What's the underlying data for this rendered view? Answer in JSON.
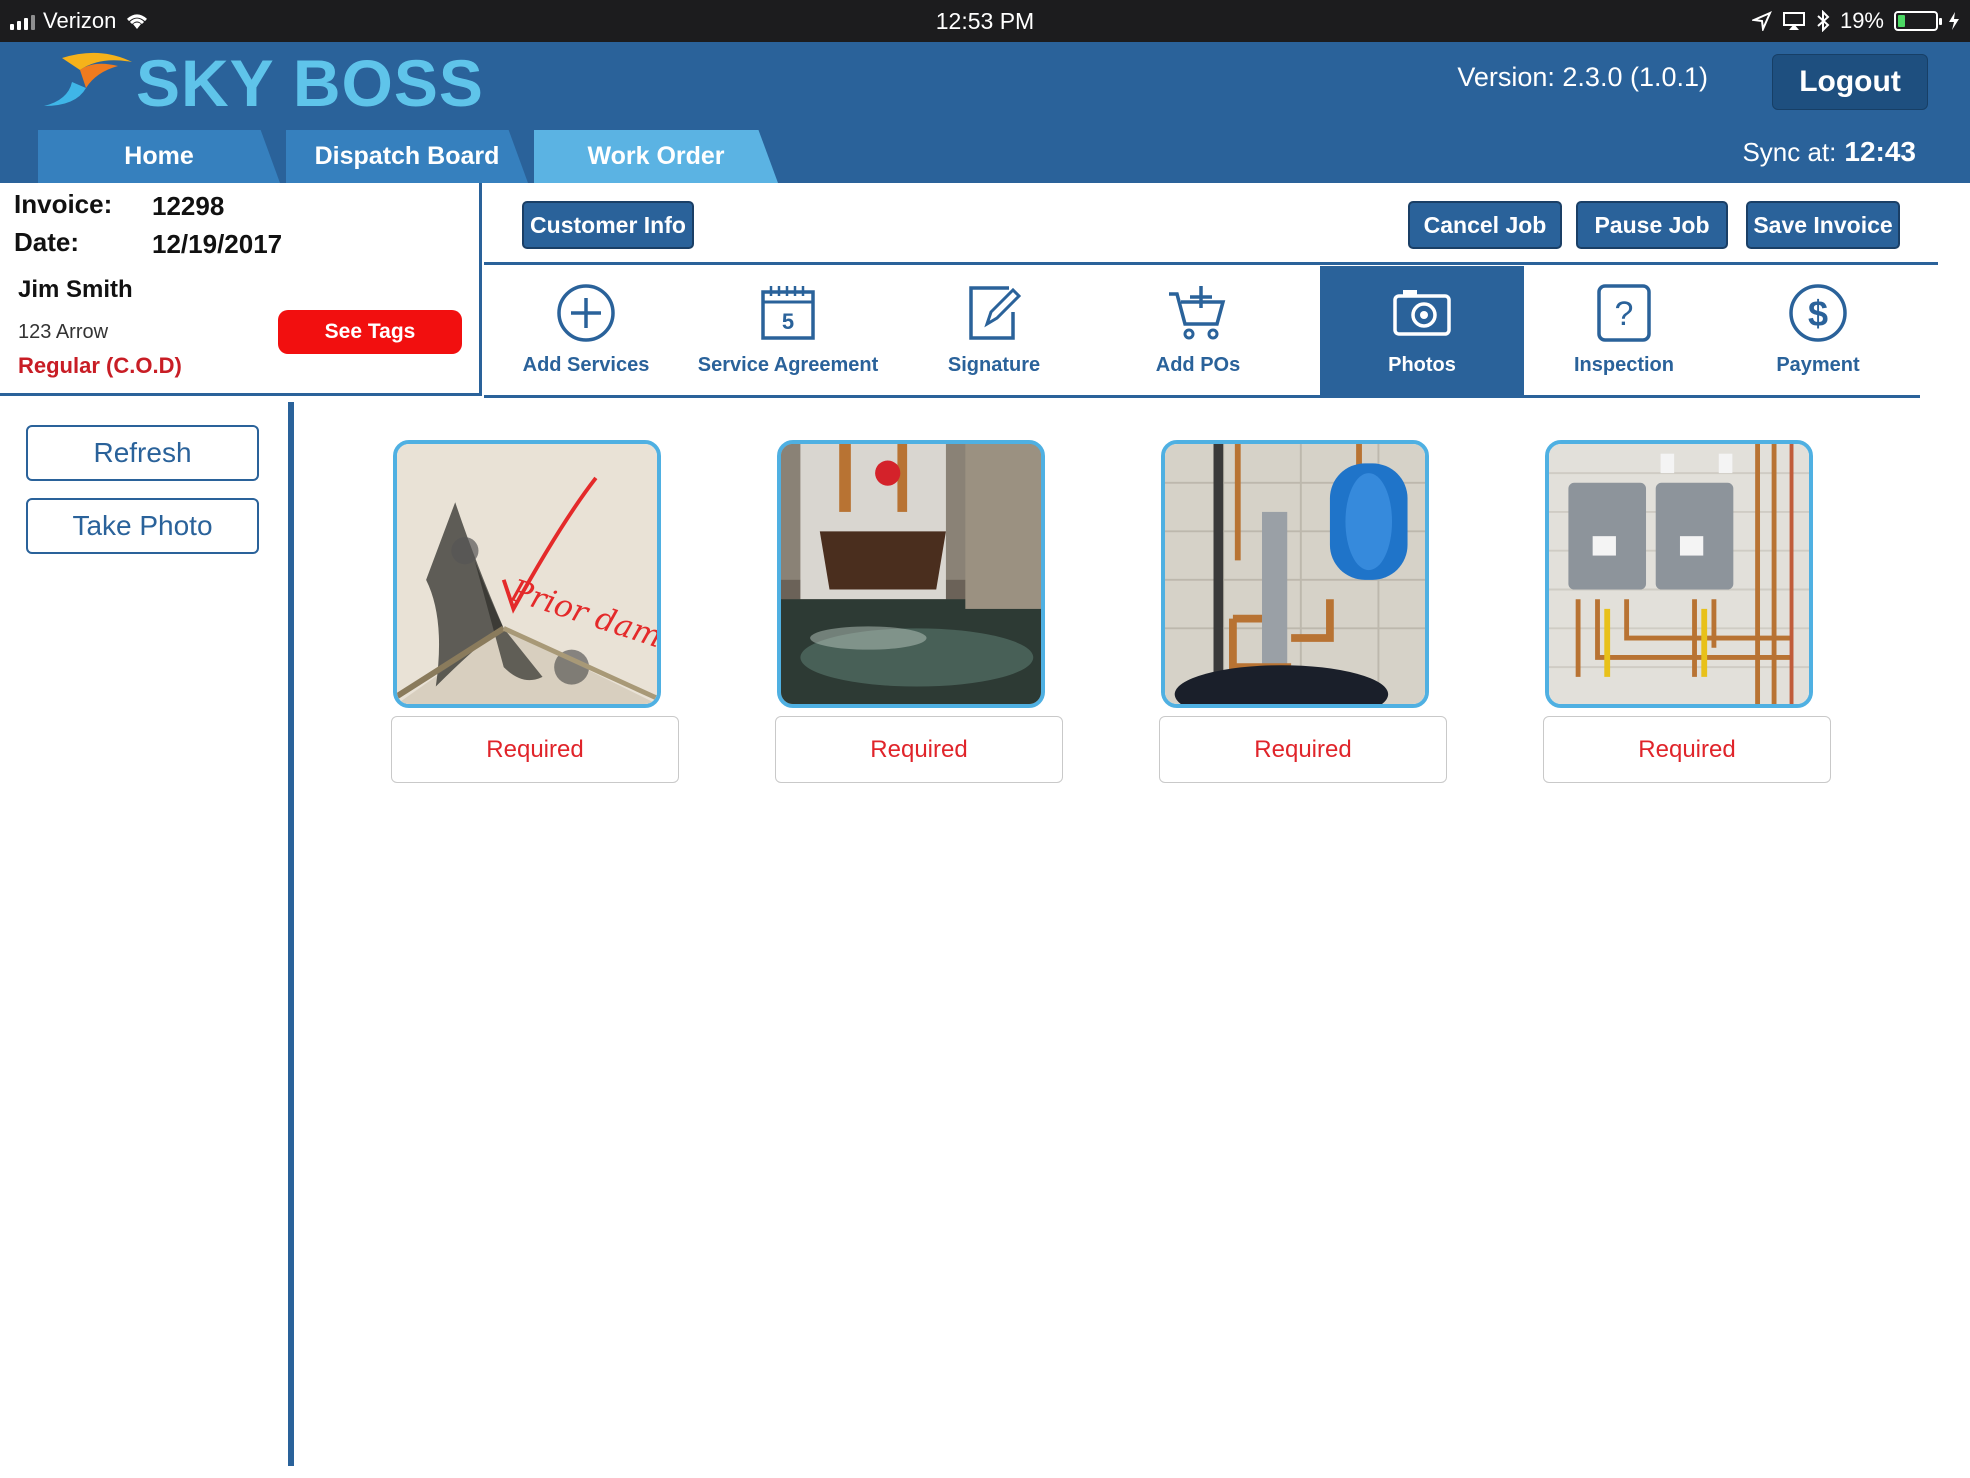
{
  "status_bar": {
    "carrier": "Verizon",
    "time": "12:53 PM",
    "battery": "19%",
    "battery_level": 0.19
  },
  "header": {
    "app_name": "SKY BOSS",
    "version": "Version: 2.3.0 (1.0.1)",
    "logout_label": "Logout"
  },
  "nav": {
    "tabs": [
      {
        "label": "Home"
      },
      {
        "label": "Dispatch Board"
      },
      {
        "label": "Work Order"
      }
    ],
    "active_tab": "Work Order",
    "sync_label": "Sync at:",
    "sync_time": "12:43"
  },
  "invoice": {
    "invoice_label": "Invoice:",
    "invoice_number": "12298",
    "date_label": "Date:",
    "date": "12/19/2017",
    "customer_name": "Jim Smith",
    "address": "123 Arrow",
    "payment_type": "Regular (C.O.D)",
    "see_tags_label": "See Tags"
  },
  "actions": {
    "customer_info": "Customer Info",
    "cancel_job": "Cancel Job",
    "pause_job": "Pause Job",
    "save_invoice": "Save Invoice"
  },
  "toolbar": {
    "items": [
      {
        "label": "Add Services",
        "icon": "plus-circle-icon"
      },
      {
        "label": "Service Agreement",
        "icon": "calendar-icon"
      },
      {
        "label": "Signature",
        "icon": "pencil-edit-icon"
      },
      {
        "label": "Add POs",
        "icon": "cart-plus-icon"
      },
      {
        "label": "Photos",
        "icon": "camera-icon"
      },
      {
        "label": "Inspection",
        "icon": "question-icon"
      },
      {
        "label": "Payment",
        "icon": "dollar-icon"
      }
    ],
    "active_item": "Photos"
  },
  "sidebar": {
    "refresh_label": "Refresh",
    "take_photo_label": "Take Photo"
  },
  "photos": [
    {
      "status": "Required",
      "caption": "Prior damage"
    },
    {
      "status": "Required"
    },
    {
      "status": "Required"
    },
    {
      "status": "Required"
    }
  ],
  "colors": {
    "brand_blue": "#2a629a",
    "active_tab": "#5bb3e3",
    "alert_red": "#f20f0f",
    "photo_border": "#4fb0e2"
  }
}
